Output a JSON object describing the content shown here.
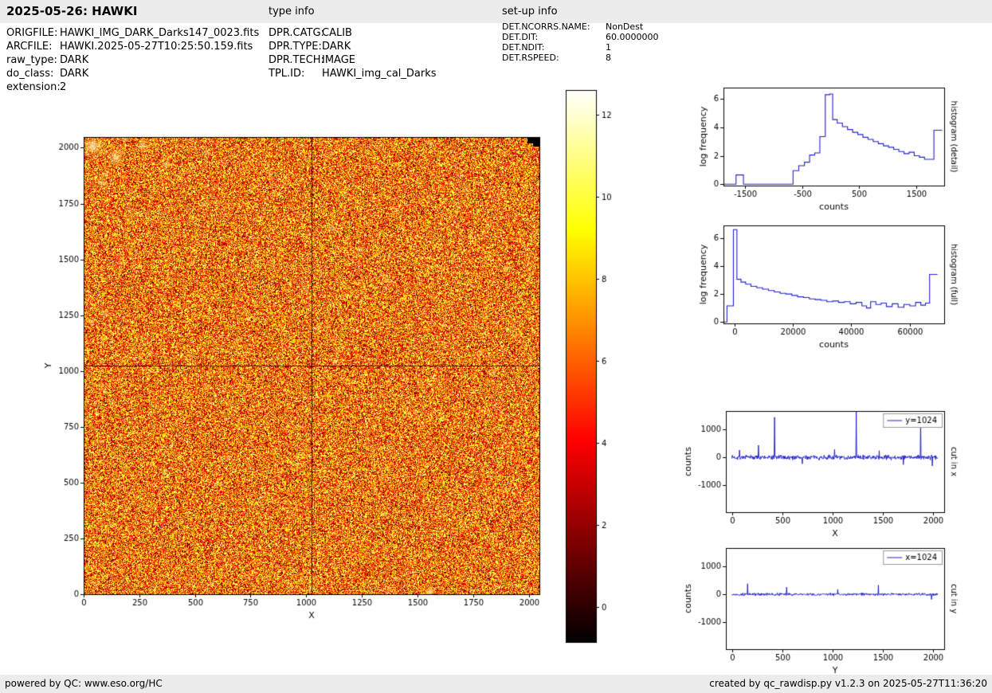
{
  "header": {
    "title": "2025-05-26: HAWKI",
    "type_info_label": "type info",
    "setup_info_label": "set-up info"
  },
  "file_info": {
    "rows": [
      {
        "label": "ORIGFILE:",
        "value": "HAWKI_IMG_DARK_Darks147_0023.fits"
      },
      {
        "label": "ARCFILE:",
        "value": "HAWKI.2025-05-27T10:25:50.159.fits"
      },
      {
        "label": "raw_type:",
        "value": "DARK"
      },
      {
        "label": "do_class:",
        "value": "DARK"
      },
      {
        "label": "extension:",
        "value": "2"
      }
    ]
  },
  "type_info": {
    "rows": [
      {
        "label": "DPR.CATG:",
        "value": "CALIB"
      },
      {
        "label": "DPR.TYPE:",
        "value": "DARK"
      },
      {
        "label": "DPR.TECH:",
        "value": "IMAGE"
      },
      {
        "label": "TPL.ID:",
        "value": "HAWKI_img_cal_Darks"
      }
    ]
  },
  "setup_info": {
    "rows": [
      {
        "label": "DET.NCORRS.NAME:",
        "value": "NonDest"
      },
      {
        "label": "DET.DIT:",
        "value": "60.0000000"
      },
      {
        "label": "DET.NDIT:",
        "value": "1"
      },
      {
        "label": "DET.RSPEED:",
        "value": "8"
      }
    ]
  },
  "footer": {
    "left": "powered by QC: www.eso.org/HC",
    "right": "created by qc_rawdisp.py v1.2.3 on 2025-05-27T11:36:20"
  },
  "colors": {
    "line": "#2222cc",
    "crosshair": "#001a7a",
    "bar_bg": "#ececec",
    "axis": "#000000"
  },
  "chart_data": [
    {
      "id": "detector-image",
      "type": "heatmap",
      "xlabel": "X",
      "ylabel": "Y",
      "xlim": [
        0,
        2048
      ],
      "ylim": [
        0,
        2048
      ],
      "xticks": [
        0,
        250,
        500,
        750,
        1000,
        1250,
        1500,
        1750,
        2000
      ],
      "yticks": [
        0,
        250,
        500,
        750,
        1000,
        1250,
        1500,
        1750,
        2000
      ],
      "colormap": "hot",
      "cut_lines": {
        "x": 1024,
        "y": 1024
      },
      "noise_seed": 42
    },
    {
      "id": "colorbar",
      "type": "colorbar",
      "colormap": "hot",
      "vmin": -0.85,
      "vmax": 12.6,
      "ticks": [
        0,
        2,
        4,
        6,
        8,
        10,
        12
      ]
    },
    {
      "id": "histogram-detail",
      "type": "step",
      "xlabel": "counts",
      "ylabel": "log frequency",
      "right_label": "histogram (detail)",
      "xlim": [
        -1880,
        1990
      ],
      "ylim": [
        -0.1,
        6.8
      ],
      "xticks": [
        -1500,
        -500,
        500,
        1500
      ],
      "yticks": [
        0,
        2,
        4,
        6
      ],
      "steps": [
        [
          -1880,
          0
        ],
        [
          -1660,
          0.65
        ],
        [
          -1530,
          0
        ],
        [
          -660,
          0.95
        ],
        [
          -560,
          1.3
        ],
        [
          -460,
          1.55
        ],
        [
          -370,
          2.05
        ],
        [
          -280,
          2.2
        ],
        [
          -190,
          3.35
        ],
        [
          -95,
          6.3
        ],
        [
          -15,
          6.35
        ],
        [
          35,
          4.55
        ],
        [
          115,
          4.3
        ],
        [
          205,
          4.05
        ],
        [
          295,
          3.85
        ],
        [
          385,
          3.65
        ],
        [
          475,
          3.5
        ],
        [
          565,
          3.3
        ],
        [
          655,
          3.15
        ],
        [
          745,
          3.0
        ],
        [
          835,
          2.85
        ],
        [
          925,
          2.7
        ],
        [
          1015,
          2.6
        ],
        [
          1105,
          2.45
        ],
        [
          1195,
          2.3
        ],
        [
          1285,
          2.15
        ],
        [
          1375,
          2.25
        ],
        [
          1465,
          2.0
        ],
        [
          1555,
          1.9
        ],
        [
          1645,
          1.75
        ],
        [
          1810,
          3.8
        ],
        [
          1955,
          3.8
        ]
      ]
    },
    {
      "id": "histogram-full",
      "type": "step",
      "xlabel": "counts",
      "ylabel": "log frequency",
      "right_label": "histogram (full)",
      "xlim": [
        -3800,
        71800
      ],
      "ylim": [
        -0.1,
        6.9
      ],
      "xticks": [
        0,
        20000,
        40000,
        60000
      ],
      "yticks": [
        0,
        2,
        4,
        6
      ],
      "steps": [
        [
          -3600,
          0
        ],
        [
          -2600,
          1.15
        ],
        [
          -400,
          6.6
        ],
        [
          800,
          3.05
        ],
        [
          2200,
          2.85
        ],
        [
          3800,
          2.7
        ],
        [
          5600,
          2.55
        ],
        [
          7600,
          2.45
        ],
        [
          9600,
          2.35
        ],
        [
          11600,
          2.25
        ],
        [
          13600,
          2.15
        ],
        [
          15600,
          2.05
        ],
        [
          17600,
          2.0
        ],
        [
          19600,
          1.9
        ],
        [
          21600,
          1.8
        ],
        [
          23600,
          1.75
        ],
        [
          25600,
          1.65
        ],
        [
          27600,
          1.6
        ],
        [
          29600,
          1.55
        ],
        [
          31600,
          1.45
        ],
        [
          33600,
          1.5
        ],
        [
          35600,
          1.4
        ],
        [
          37600,
          1.45
        ],
        [
          39600,
          1.3
        ],
        [
          41600,
          1.4
        ],
        [
          43600,
          1.15
        ],
        [
          45200,
          1.0
        ],
        [
          46600,
          1.45
        ],
        [
          48400,
          1.25
        ],
        [
          50200,
          1.35
        ],
        [
          52000,
          1.1
        ],
        [
          54000,
          1.3
        ],
        [
          56000,
          1.05
        ],
        [
          58000,
          1.25
        ],
        [
          60000,
          1.15
        ],
        [
          62000,
          1.4
        ],
        [
          63800,
          1.2
        ],
        [
          65400,
          1.35
        ],
        [
          66800,
          3.4
        ],
        [
          69500,
          3.4
        ]
      ]
    },
    {
      "id": "cut-in-x",
      "type": "cut",
      "xlabel": "X",
      "ylabel": "counts",
      "right_label": "cut in x",
      "legend": "y=1024",
      "xlim": [
        -60,
        2110
      ],
      "ylim": [
        -1950,
        1650
      ],
      "xticks": [
        0,
        500,
        1000,
        1500,
        2000
      ],
      "yticks": [
        -1000,
        0,
        1000
      ],
      "noise_amp": 100,
      "noise_seed": 7,
      "spikes": [
        [
          75,
          260
        ],
        [
          265,
          430
        ],
        [
          425,
          1430
        ],
        [
          700,
          -230
        ],
        [
          1020,
          280
        ],
        [
          1235,
          1640
        ],
        [
          1465,
          240
        ],
        [
          1705,
          -260
        ],
        [
          1875,
          1300
        ],
        [
          1990,
          -300
        ]
      ]
    },
    {
      "id": "cut-in-y",
      "type": "cut",
      "xlabel": "Y",
      "ylabel": "counts",
      "right_label": "cut in y",
      "legend": "x=1024",
      "xlim": [
        -60,
        2110
      ],
      "ylim": [
        -1950,
        1650
      ],
      "xticks": [
        0,
        500,
        1000,
        1500,
        2000
      ],
      "yticks": [
        -1000,
        0,
        1000
      ],
      "noise_amp": 60,
      "noise_seed": 13,
      "spikes": [
        [
          155,
          380
        ],
        [
          545,
          260
        ],
        [
          1050,
          180
        ],
        [
          1455,
          330
        ],
        [
          1985,
          -180
        ]
      ]
    }
  ]
}
